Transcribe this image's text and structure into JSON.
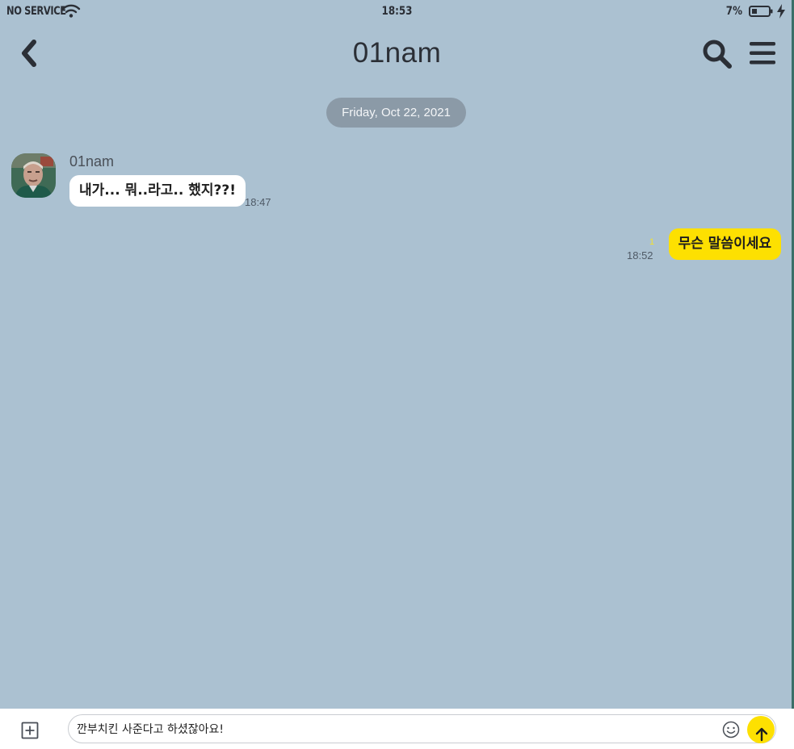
{
  "status_bar": {
    "carrier": "NO SERVICE",
    "time": "18:53",
    "battery_percent": "7%"
  },
  "header": {
    "title": "01nam",
    "icons": [
      "chevron-left-icon",
      "search-icon",
      "hamburger-menu-icon"
    ]
  },
  "chat": {
    "date_divider": "Friday, Oct 22, 2021",
    "messages": [
      {
        "direction": "received",
        "sender": "01nam",
        "text": "내가... 뭐..라고.. 했지??!",
        "time": "18:47"
      },
      {
        "direction": "sent",
        "text": "무슨 말씀이세요",
        "unread_count": "1",
        "time": "18:52"
      }
    ]
  },
  "composer": {
    "value": "깐부치킨 사준다고 하셨잖아요!",
    "icons": [
      "plus-square-icon",
      "smiley-icon",
      "arrow-up-icon"
    ]
  },
  "colors": {
    "background": "#abc1d1",
    "sent_bubble": "#fde001",
    "received_bubble": "#ffffff",
    "date_chip": "#8b9aa7"
  }
}
